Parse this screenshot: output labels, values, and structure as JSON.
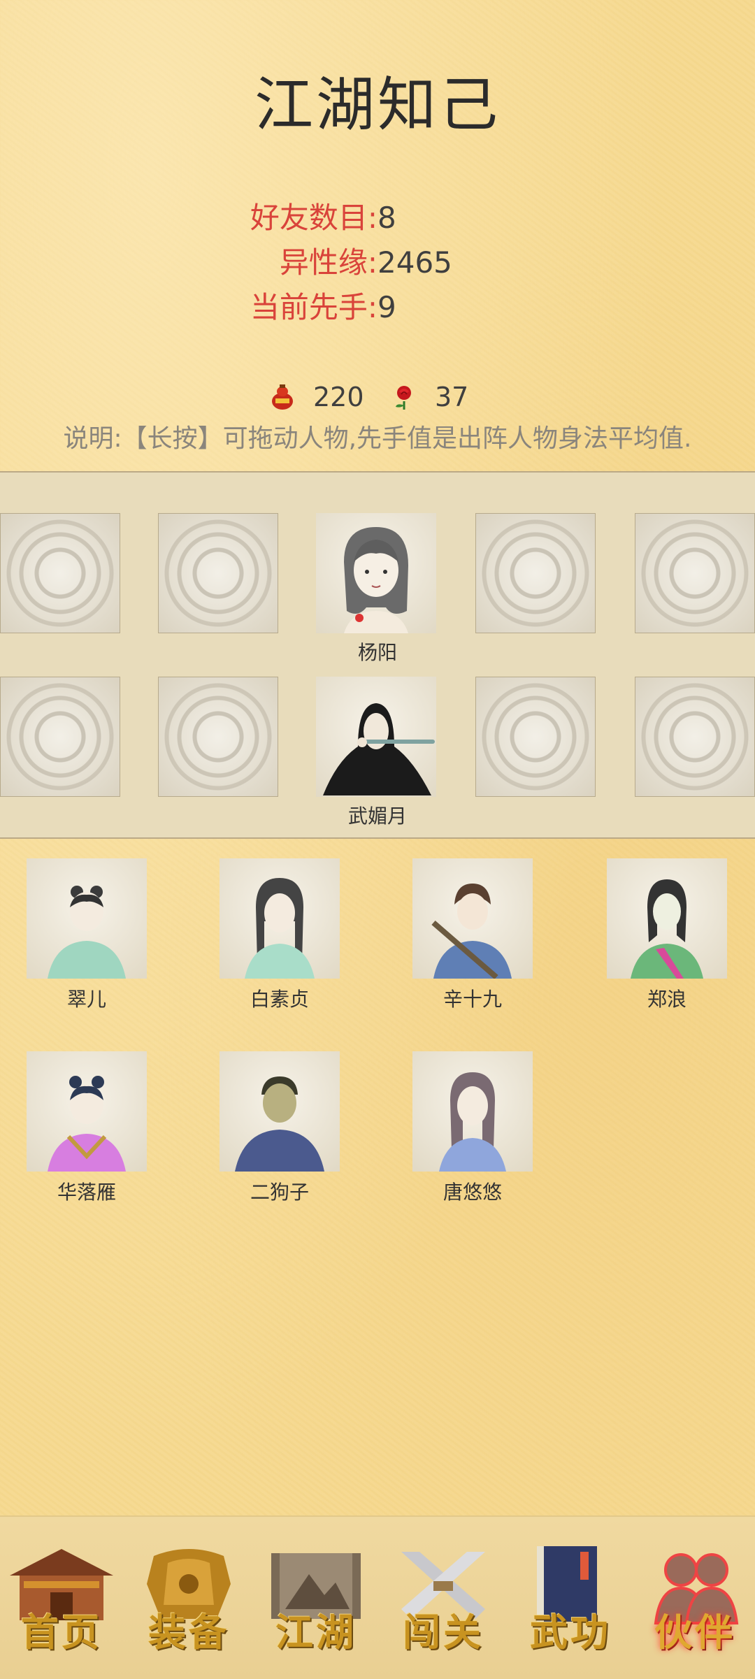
{
  "page": {
    "title": "江湖知己"
  },
  "stats": [
    {
      "label": "好友数目:",
      "value": "8"
    },
    {
      "label": "异性缘:",
      "value": "2465"
    },
    {
      "label": "当前先手:",
      "value": "9"
    }
  ],
  "currency": {
    "gourd": {
      "icon": "wine-gourd-icon",
      "value": "220"
    },
    "rose": {
      "icon": "rose-icon",
      "value": "37"
    }
  },
  "note": "说明:【长按】可拖动人物,先手值是出阵人物身法平均值.",
  "lineup": {
    "row1_name": "杨阳",
    "row2_name": "武媚月"
  },
  "friends": [
    {
      "name": "翠儿"
    },
    {
      "name": "白素贞"
    },
    {
      "name": "辛十九"
    },
    {
      "name": "郑浪"
    },
    {
      "name": "华落雁"
    },
    {
      "name": "二狗子"
    },
    {
      "name": "唐悠悠"
    }
  ],
  "nav": [
    {
      "label": "首页",
      "icon": "house-icon"
    },
    {
      "label": "装备",
      "icon": "armor-icon"
    },
    {
      "label": "江湖",
      "icon": "scroll-map-icon"
    },
    {
      "label": "闯关",
      "icon": "crossed-swords-icon"
    },
    {
      "label": "武功",
      "icon": "book-icon"
    },
    {
      "label": "伙伴",
      "icon": "partners-icon",
      "active": true
    }
  ],
  "colors": {
    "accent_red": "#d9433a",
    "text_dark": "#2b2b2b",
    "nav_gold": "#c89320"
  }
}
